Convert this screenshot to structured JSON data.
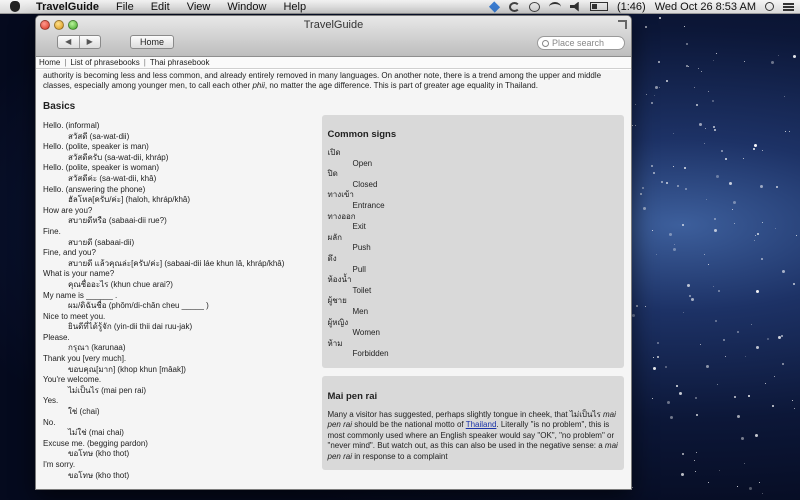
{
  "menubar": {
    "app_name": "TravelGuide",
    "menus": [
      "File",
      "Edit",
      "View",
      "Window",
      "Help"
    ],
    "battery": "(1:46)",
    "clock": "Wed Oct 26  8:53 AM",
    "status_icons": [
      "dropbox-icon",
      "sync-icon",
      "time-machine-icon",
      "wifi-icon",
      "volume-icon",
      "battery-icon",
      "spotlight-icon",
      "notification-list-icon"
    ]
  },
  "window": {
    "title": "TravelGuide",
    "back_label": "◀",
    "forward_label": "▶",
    "home_label": "Home",
    "search_placeholder": "Place search"
  },
  "breadcrumb": [
    "Home",
    "List of phrasebooks",
    "Thai phrasebook"
  ],
  "intro": {
    "part1": "authority is becoming less and less common, and already entirely removed in many languages. On another note, there is a trend among the upper and middle classes, especially among younger men, to call each other ",
    "emph": "phii",
    "part2": ", no matter the age difference. This is part of greater age equality in Thailand."
  },
  "basics": {
    "heading": "Basics",
    "phrases": [
      {
        "en": "Hello. (informal)",
        "th": "สวัสดี (sa-wat-dii)"
      },
      {
        "en": "Hello. (polite, speaker is man)",
        "th": "สวัสดีครับ (sa-wat-dii, khráp)"
      },
      {
        "en": "Hello. (polite, speaker is woman)",
        "th": "สวัสดีค่ะ (sa-wat-dii, khâ)"
      },
      {
        "en": "Hello. (answering the phone)",
        "th": "ฮัลโหล[ครับ/ค่ะ] (haloh, khráp/khâ)"
      },
      {
        "en": "How are you?",
        "th": "สบายดีหรือ (sabaai-dii rue?)"
      },
      {
        "en": "Fine.",
        "th": "สบายดี (sabaai-dii)"
      },
      {
        "en": "Fine, and you?",
        "th": "สบายดี แล้วคุณล่ะ[ครับ/ค่ะ] (sabaai-dii láe khun lâ, khráp/khâ)"
      },
      {
        "en": "What is your name?",
        "th": "คุณชื่ออะไร (khun chue arai?)"
      },
      {
        "en": "My name is ______ .",
        "th": "ผม/ดิฉันชื่อ (phŏm/di-chăn cheu _____ )"
      },
      {
        "en": "Nice to meet you.",
        "th": "ยินดีที่ได้รู้จัก (yin-dii thii dai ruu-jak)"
      },
      {
        "en": "Please.",
        "th": "กรุณา (karunaa)"
      },
      {
        "en": "Thank you [very much].",
        "th": "ขอบคุณ[มาก] (khop khun [mâak])"
      },
      {
        "en": "You're welcome.",
        "th": "ไม่เป็นไร (mai pen rai)"
      },
      {
        "en": "Yes.",
        "th": "ใช่ (chai)"
      },
      {
        "en": "No.",
        "th": "ไม่ใช่ (mai chai)"
      },
      {
        "en": "Excuse me. (begging pardon)",
        "th": "ขอโทษ (kho thot)"
      },
      {
        "en": "I'm sorry.",
        "th": "ขอโทษ (kho thot)"
      }
    ]
  },
  "common_signs": {
    "heading": "Common signs",
    "signs": [
      {
        "th": "เปิด",
        "en": "Open"
      },
      {
        "th": "ปิด",
        "en": "Closed"
      },
      {
        "th": "ทางเข้า",
        "en": "Entrance"
      },
      {
        "th": "ทางออก",
        "en": "Exit"
      },
      {
        "th": "ผลัก",
        "en": "Push"
      },
      {
        "th": "ดึง",
        "en": "Pull"
      },
      {
        "th": "ห้องน้ำ",
        "en": "Toilet"
      },
      {
        "th": "ผู้ชาย",
        "en": "Men"
      },
      {
        "th": "ผู้หญิง",
        "en": "Women"
      },
      {
        "th": "ห้าม",
        "en": "Forbidden"
      }
    ]
  },
  "mai_pen_rai": {
    "heading": "Mai pen rai",
    "text1": "Many a visitor has suggested, perhaps slightly tongue in cheek, that ",
    "thai": "ไม่เป็นไร",
    "text2": " mai pen rai",
    "text3": " should be the national motto of ",
    "link": "Thailand",
    "text4": ". Literally \"is no problem\", this is most commonly used where an English speaker would say \"OK\", \"no problem\" or \"never mind\". But watch out, as this can also be used in the negative sense: a ",
    "text5": "mai pen rai",
    "text6": " in response to a complaint"
  }
}
